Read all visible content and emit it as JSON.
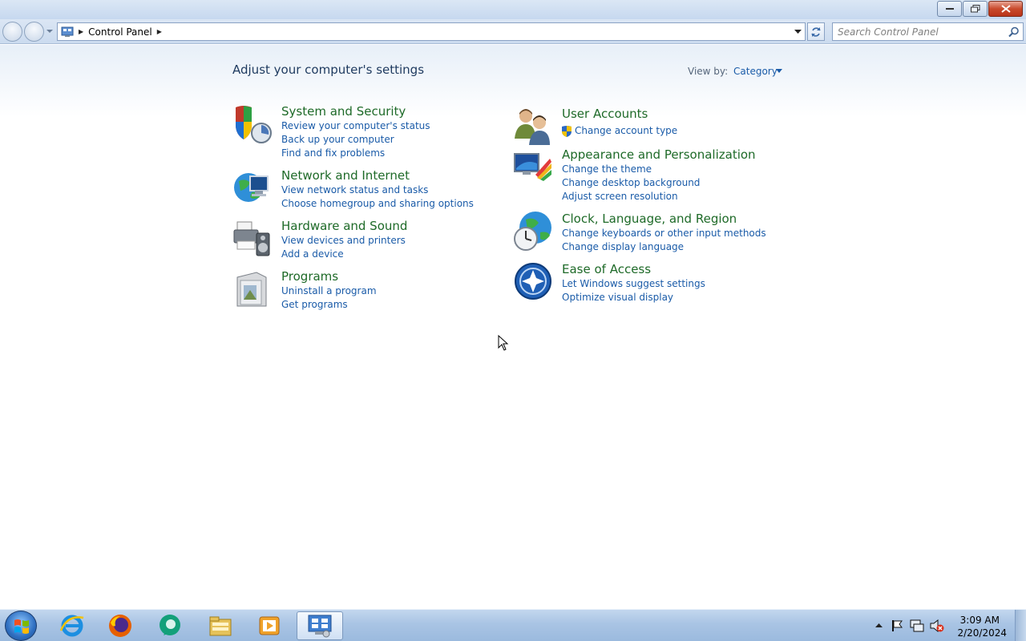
{
  "address_bar": {
    "breadcrumb": "Control Panel",
    "search_placeholder": "Search Control Panel"
  },
  "main": {
    "page_title": "Adjust your computer's settings",
    "view_by_label": "View by:",
    "view_by_value": "Category"
  },
  "categories": [
    {
      "title": "System and Security",
      "icon": "shield-icon",
      "links": [
        "Review your computer's status",
        "Back up your computer",
        "Find and fix problems"
      ]
    },
    {
      "title": "Network and Internet",
      "icon": "network-globe-icon",
      "links": [
        "View network status and tasks",
        "Choose homegroup and sharing options"
      ]
    },
    {
      "title": "Hardware and Sound",
      "icon": "printer-speaker-icon",
      "links": [
        "View devices and printers",
        "Add a device"
      ]
    },
    {
      "title": "Programs",
      "icon": "programs-box-icon",
      "links": [
        "Uninstall a program",
        "Get programs"
      ]
    },
    {
      "title": "User Accounts",
      "icon": "users-icon",
      "links": [
        "Change account type"
      ]
    },
    {
      "title": "Appearance and Personalization",
      "icon": "monitor-palette-icon",
      "links": [
        "Change the theme",
        "Change desktop background",
        "Adjust screen resolution"
      ]
    },
    {
      "title": "Clock, Language, and Region",
      "icon": "globe-clock-icon",
      "links": [
        "Change keyboards or other input methods",
        "Change display language"
      ]
    },
    {
      "title": "Ease of Access",
      "icon": "ease-of-access-icon",
      "links": [
        "Let Windows suggest settings",
        "Optimize visual display"
      ]
    }
  ],
  "taskbar": {
    "apps": [
      "internet-explorer-icon",
      "firefox-icon",
      "chat-bubble-app-icon",
      "file-explorer-icon",
      "media-player-icon",
      "control-panel-icon"
    ],
    "time": "3:09 AM",
    "date": "2/20/2024"
  },
  "colors": {
    "category_title": "#1e6a28",
    "link": "#1a5ba8",
    "taskbar": "#a9c4e4"
  }
}
